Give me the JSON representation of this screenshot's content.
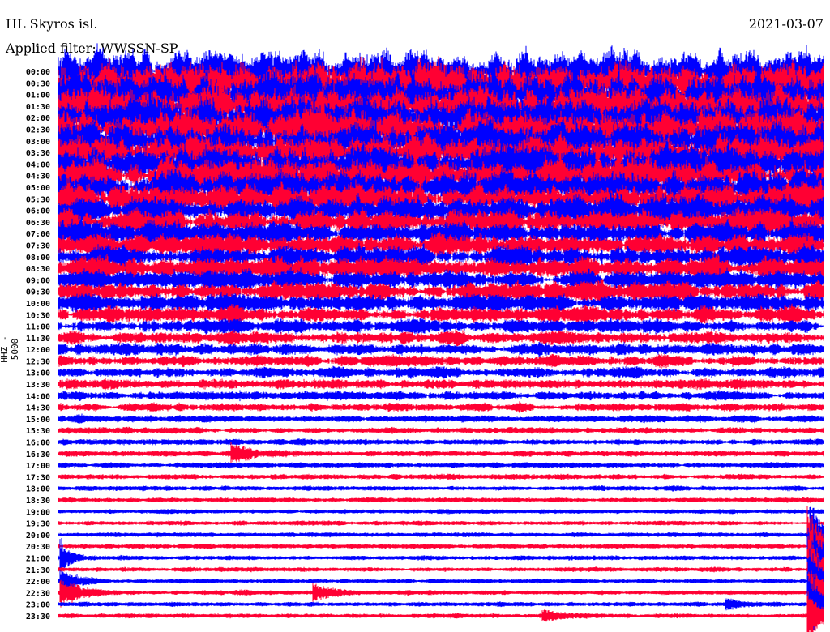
{
  "header": {
    "station": "HL Skyros isl.",
    "date": "2021-03-07",
    "filter": "Applied filter: WWSSN-SP",
    "channel": "HHZ - 5000"
  },
  "chart_data": {
    "type": "line",
    "title": "HL Skyros isl. 2021-03-07",
    "ylabel": "HHZ - 5000",
    "xlabel": "",
    "minutes_per_line": 30,
    "colors": [
      "#0000ff",
      "#ff0033"
    ],
    "rows": [
      "00:00",
      "00:30",
      "01:00",
      "01:30",
      "02:00",
      "02:30",
      "03:00",
      "03:30",
      "04:00",
      "04:30",
      "05:00",
      "05:30",
      "06:00",
      "06:30",
      "07:00",
      "07:30",
      "08:00",
      "08:30",
      "09:00",
      "09:30",
      "10:00",
      "10:30",
      "11:00",
      "11:30",
      "12:00",
      "12:30",
      "13:00",
      "13:30",
      "14:00",
      "14:30",
      "15:00",
      "15:30",
      "16:00",
      "16:30",
      "17:00",
      "17:30",
      "18:00",
      "18:30",
      "19:00",
      "19:30",
      "20:00",
      "20:30",
      "21:00",
      "21:30",
      "22:00",
      "22:30",
      "23:00",
      "23:30"
    ],
    "noise_amplitude": [
      1.0,
      1.0,
      1.0,
      0.98,
      0.97,
      0.95,
      0.93,
      0.9,
      0.85,
      0.8,
      0.75,
      0.7,
      0.65,
      0.6,
      0.55,
      0.52,
      0.5,
      0.48,
      0.45,
      0.42,
      0.38,
      0.34,
      0.3,
      0.27,
      0.25,
      0.23,
      0.22,
      0.2,
      0.19,
      0.16,
      0.13,
      0.11,
      0.1,
      0.1,
      0.09,
      0.09,
      0.08,
      0.08,
      0.07,
      0.07,
      0.07,
      0.07,
      0.07,
      0.07,
      0.07,
      0.07,
      0.07,
      0.07
    ],
    "events": [
      {
        "row": "16:30",
        "minute": 6.8,
        "amplitude": 0.6,
        "duration": 1.0
      },
      {
        "row": "21:00",
        "minute": 0.1,
        "amplitude": 1.2,
        "duration": 0.3
      },
      {
        "row": "22:00",
        "minute": 0.1,
        "amplitude": 0.8,
        "duration": 0.6
      },
      {
        "row": "22:30",
        "minute": 0.1,
        "amplitude": 0.8,
        "duration": 0.8
      },
      {
        "row": "22:30",
        "minute": 10.0,
        "amplitude": 0.6,
        "duration": 0.6
      },
      {
        "row": "23:00",
        "minute": 26.2,
        "amplitude": 0.3,
        "duration": 0.8
      },
      {
        "row": "23:30",
        "minute": 19.0,
        "amplitude": 0.35,
        "duration": 0.8
      },
      {
        "row": "20:00",
        "minute": 29.5,
        "amplitude": 2.0,
        "duration": 0.5
      },
      {
        "row": "20:30",
        "minute": 29.4,
        "amplitude": 2.5,
        "duration": 0.6
      },
      {
        "row": "21:00",
        "minute": 29.4,
        "amplitude": 2.5,
        "duration": 0.6
      },
      {
        "row": "21:30",
        "minute": 29.4,
        "amplitude": 2.5,
        "duration": 0.6
      },
      {
        "row": "22:00",
        "minute": 29.4,
        "amplitude": 2.5,
        "duration": 0.6
      },
      {
        "row": "22:30",
        "minute": 29.4,
        "amplitude": 2.2,
        "duration": 0.6
      },
      {
        "row": "23:00",
        "minute": 29.4,
        "amplitude": 2.0,
        "duration": 0.6
      },
      {
        "row": "23:30",
        "minute": 29.4,
        "amplitude": 1.5,
        "duration": 0.6
      }
    ]
  }
}
